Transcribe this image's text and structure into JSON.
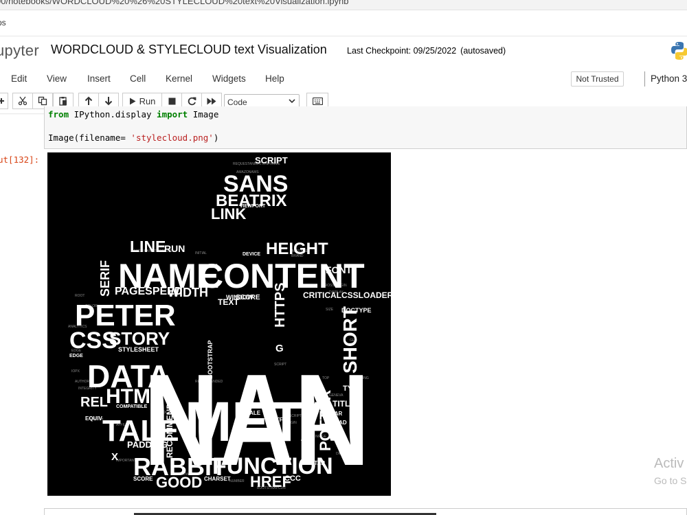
{
  "browser": {
    "url": "00/notebooks/WORDCLOUD%20%26%20STYLECLOUD%20text%20Visualization.ipynb",
    "bookmarks": "ps"
  },
  "header": {
    "logo": "upyter",
    "notebook_title": "WORDCLOUD & STYLECLOUD text Visualization",
    "checkpoint": "Last Checkpoint: 09/25/2022",
    "autosaved": "(autosaved)"
  },
  "menu": {
    "items": [
      "Edit",
      "View",
      "Insert",
      "Cell",
      "Kernel",
      "Widgets",
      "Help"
    ],
    "trust_badge": "Not Trusted",
    "kernel": "Python 3"
  },
  "toolbar": {
    "run_label": "Run",
    "cell_type": "Code"
  },
  "cell": {
    "line1": {
      "kw1": "from",
      "module": " IPython.display ",
      "kw2": "import",
      "name": " Image"
    },
    "line2": {
      "call": "Image(filename= ",
      "arg": "'stylecloud.png'",
      "close": ")"
    },
    "out_prompt": "ut[132]:"
  },
  "wordcloud": {
    "words": {
      "nan": "NAN",
      "meta": "META",
      "content": "CONTENT",
      "name": "NAME",
      "peter": "PETER",
      "data": "DATA",
      "tale": "TALE",
      "rabbit": "RABBIT",
      "function": "FUNCTION",
      "css": "CSS",
      "story": "STORY",
      "sans": "SANS",
      "beatrix": "BEATRIX",
      "link": "LINK",
      "line": "LINE",
      "height": "HEIGHT",
      "html": "HTML",
      "rel": "REL",
      "serif": "SERIF",
      "pagespeed": "PAGESPEED",
      "width": "WIDTH",
      "short": "SHORT",
      "potter": "POTTER",
      "https": "HTTPS",
      "font": "FONT",
      "good": "GOOD",
      "href": "HREF",
      "padding": "PADDING",
      "text": "TEXT",
      "criticalcssloader": "CRITICALCSSLOADER",
      "script": "SCRIPT",
      "title": "TITLE",
      "type": "TYPE",
      "stylesheet": "STYLESHEET",
      "recommended": "RECOMMENDED",
      "doctype": "DOCTYPE",
      "bootstrap": "BOOTSTRAP",
      "score": "SCORE",
      "x": "X",
      "run": "RUN",
      "ccc": "CCC",
      "g": "G",
      "viewport": "VIEWPORT",
      "device": "DEVICE",
      "charset": "CHARSET",
      "head": "HEAD",
      "var": "VAR",
      "utf": "UTF",
      "scale": "SCALE",
      "window": "WINDOW",
      "edge": "EDGE",
      "compatible": "COMPATIBLE",
      "equiv": "EQUIV",
      "star": "STAR"
    }
  },
  "watermark": {
    "line1": "Activ",
    "line2": "Go to S"
  }
}
